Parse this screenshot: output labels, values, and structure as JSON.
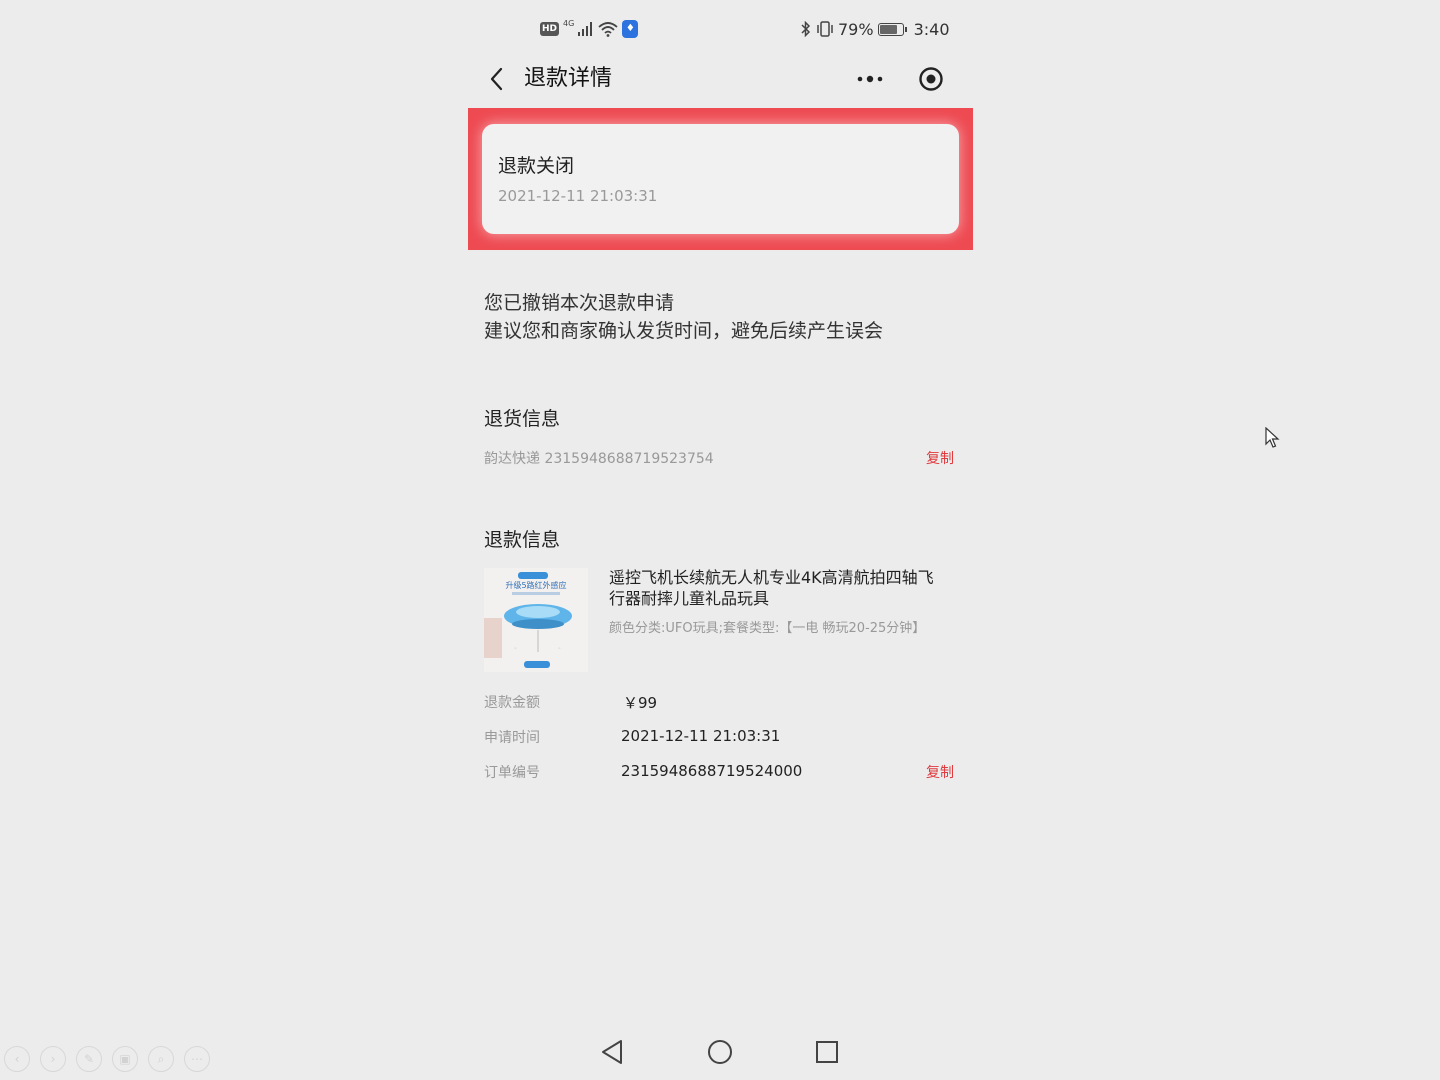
{
  "status_bar": {
    "hd": "HD",
    "network": "4G",
    "battery_percent": "79%",
    "battery_level": 0.79,
    "time": "3:40",
    "icons": [
      "signal-icon",
      "wifi-icon",
      "shield-icon",
      "bluetooth-icon",
      "vibrate-icon",
      "battery-icon"
    ]
  },
  "header": {
    "title": "退款详情",
    "back_icon": "chevron-left-icon",
    "more_icon": "more-dots-icon",
    "record_icon": "record-icon"
  },
  "status_card": {
    "title": "退款关闭",
    "time": "2021-12-11 21:03:31",
    "highlight_color": "#ee4a52"
  },
  "notice": {
    "line1": "您已撤销本次退款申请",
    "line2": "建议您和商家确认发货时间，避免后续产生误会"
  },
  "return_info": {
    "title": "退货信息",
    "tracking": "韵达快递 2315948688719523754",
    "copy_label": "复制"
  },
  "refund_info": {
    "title": "退款信息",
    "product": {
      "title": "遥控飞机长续航无人机专业4K高清航拍四轴飞行器耐摔儿童礼品玩具",
      "spec": "颜色分类:UFO玩具;套餐类型:【一电 畅玩20-25分钟】",
      "image_caption": "升级5路红外感应"
    },
    "rows": [
      {
        "label": "退款金额",
        "value": "￥99"
      },
      {
        "label": "申请时间",
        "value": "2021-12-11 21:03:31"
      },
      {
        "label": "订单编号",
        "value": "2315948688719524000"
      }
    ],
    "copy_label": "复制"
  },
  "colors": {
    "accent": "#e0393e",
    "background": "#ececec"
  }
}
